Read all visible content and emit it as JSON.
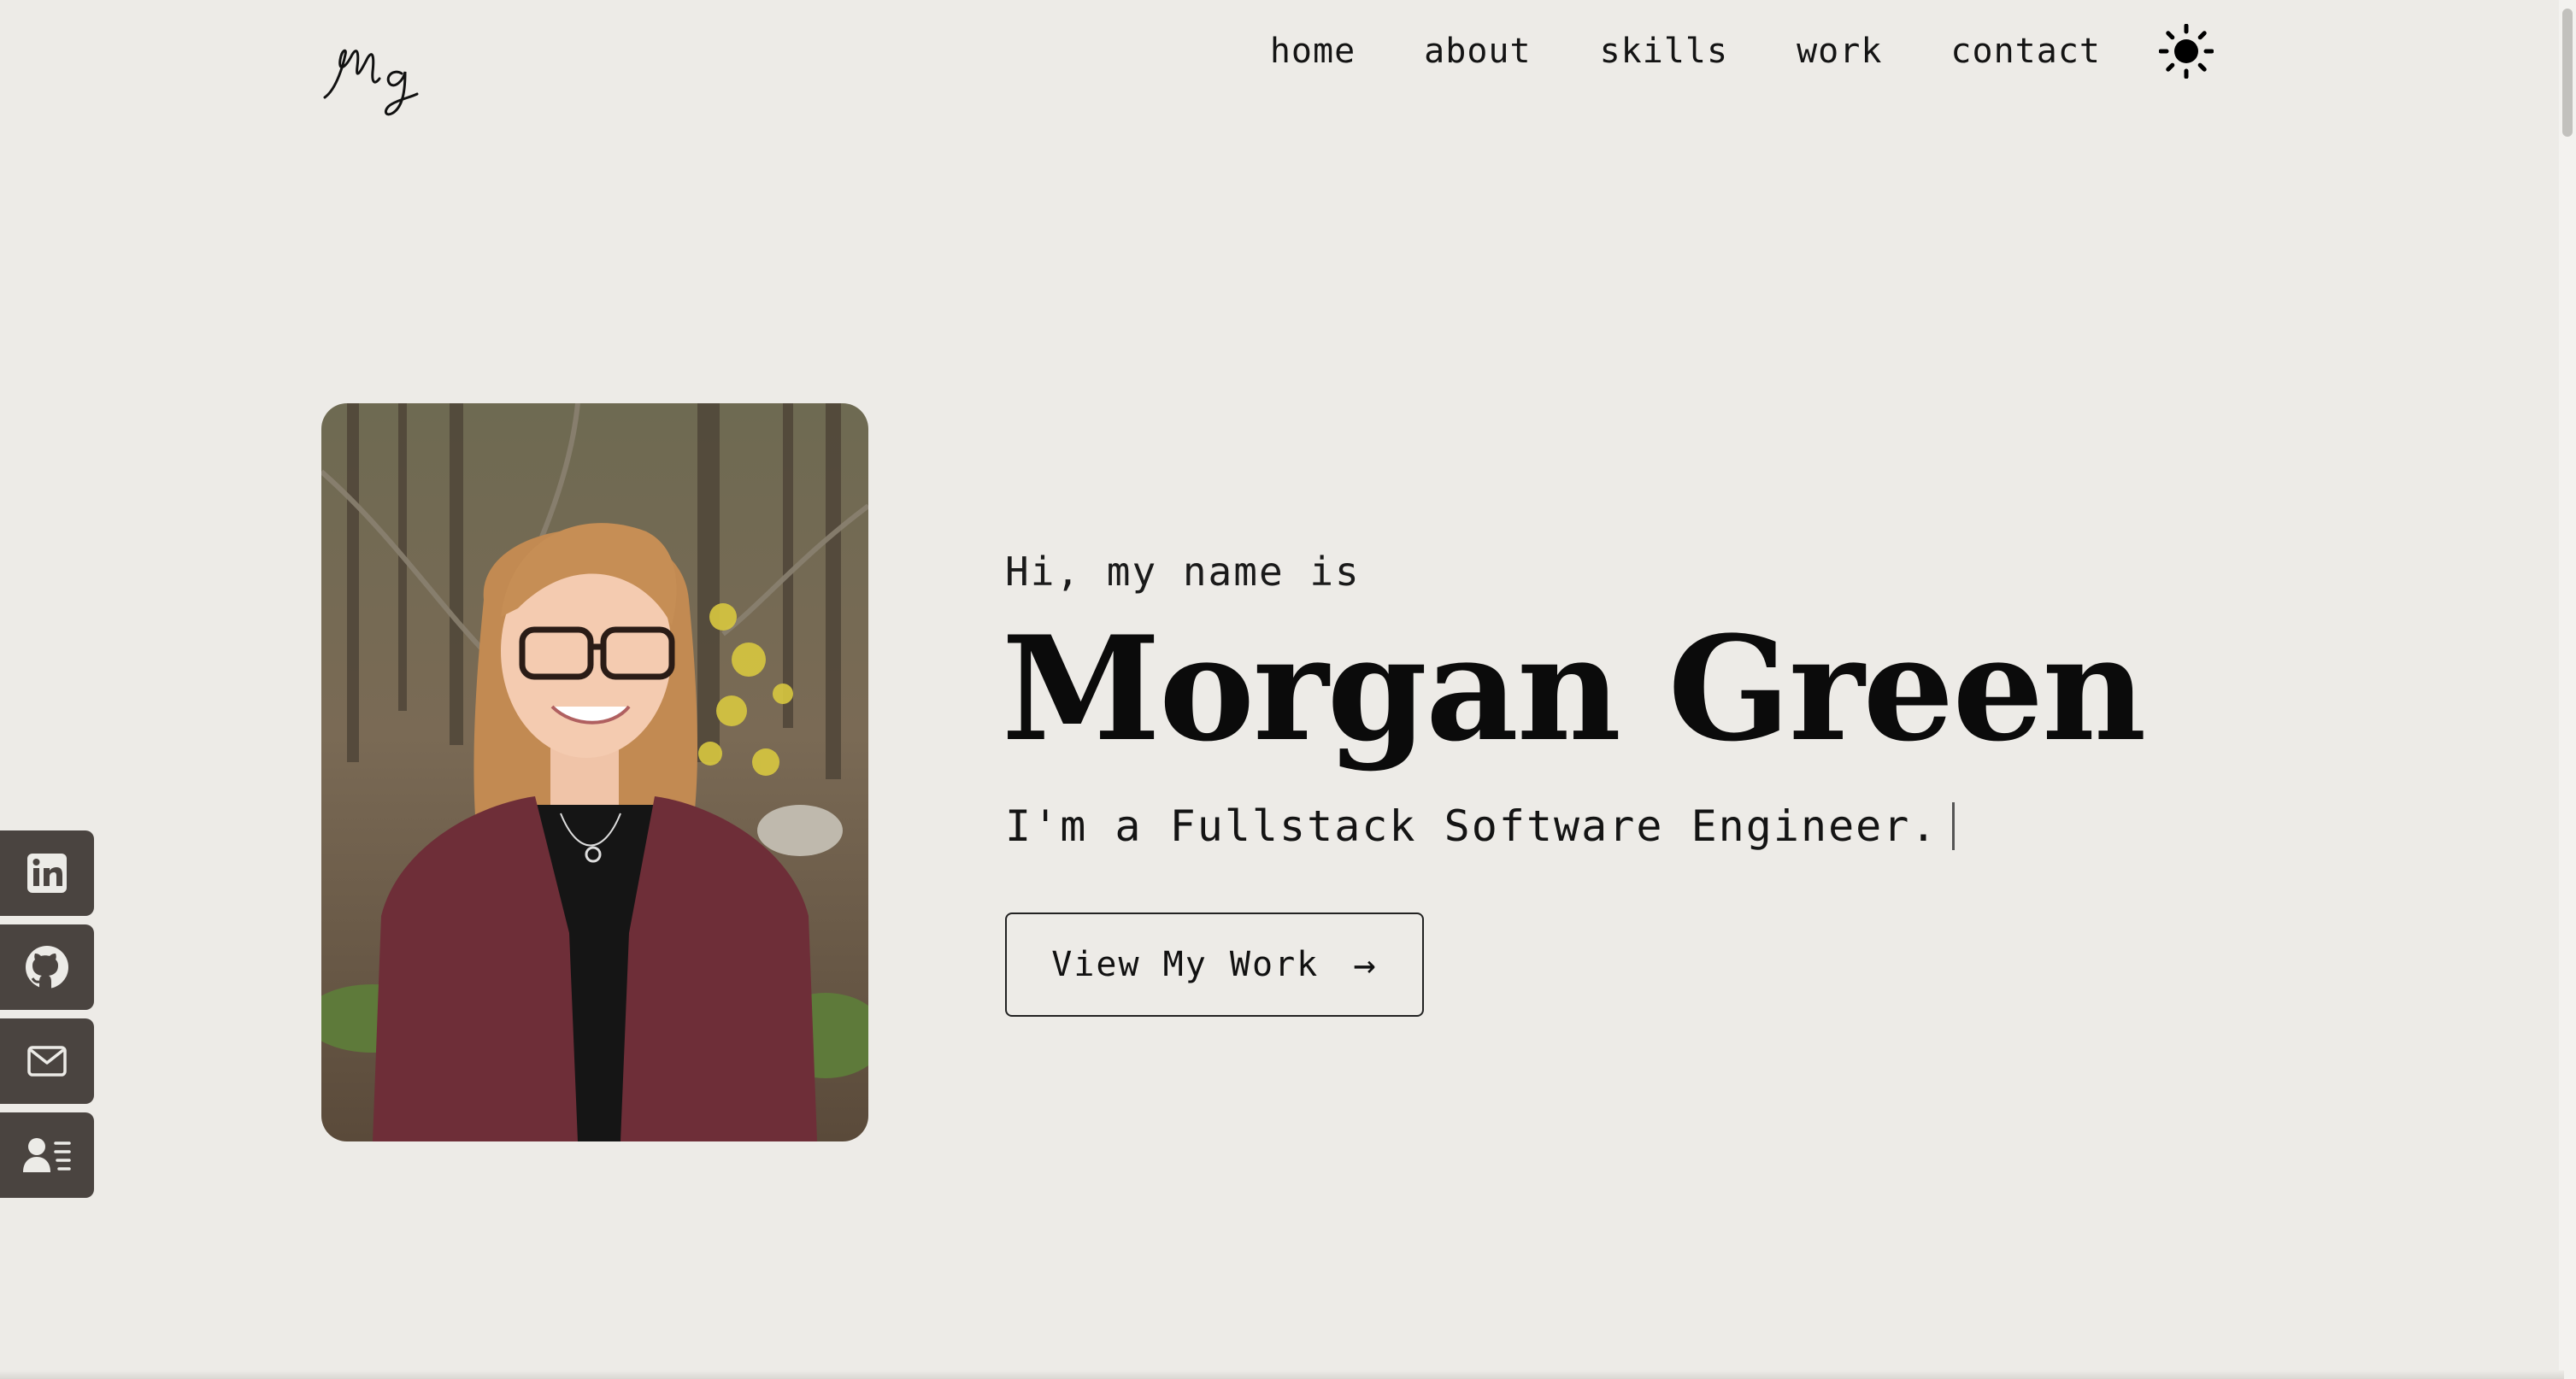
{
  "header": {
    "logo_text": "Mg",
    "nav": [
      {
        "label": "home"
      },
      {
        "label": "about"
      },
      {
        "label": "skills"
      },
      {
        "label": "work"
      },
      {
        "label": "contact"
      }
    ],
    "theme_icon": "sun-icon"
  },
  "social": [
    {
      "icon": "linkedin-icon"
    },
    {
      "icon": "github-icon"
    },
    {
      "icon": "mail-icon"
    },
    {
      "icon": "resume-icon"
    }
  ],
  "hero": {
    "intro": "Hi, my name is",
    "name": "Morgan Green",
    "tagline": "I'm a Fullstack Software Engineer.",
    "cta_label": "View My Work",
    "cta_arrow": "→",
    "photo_icon": "profile-photo"
  },
  "colors": {
    "background": "#edebe7",
    "social_button": "#4a4440",
    "text": "#111111"
  }
}
